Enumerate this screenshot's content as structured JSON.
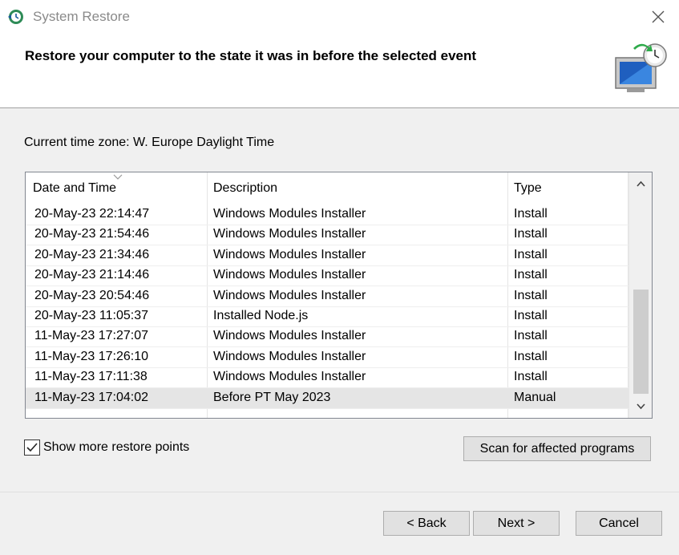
{
  "window": {
    "title": "System Restore",
    "close_label": "×"
  },
  "header": {
    "text": "Restore your computer to the state it was in before the selected event"
  },
  "timezone": {
    "label": "Current time zone: W. Europe Daylight Time"
  },
  "list": {
    "columns": [
      "Date and Time",
      "Description",
      "Type"
    ],
    "rows": [
      {
        "date": "20-May-23 22:14:47",
        "description": "Windows Modules Installer",
        "type": "Install"
      },
      {
        "date": "20-May-23 21:54:46",
        "description": "Windows Modules Installer",
        "type": "Install"
      },
      {
        "date": "20-May-23 21:34:46",
        "description": "Windows Modules Installer",
        "type": "Install"
      },
      {
        "date": "20-May-23 21:14:46",
        "description": "Windows Modules Installer",
        "type": "Install"
      },
      {
        "date": "20-May-23 20:54:46",
        "description": "Windows Modules Installer",
        "type": "Install"
      },
      {
        "date": "20-May-23 11:05:37",
        "description": "Installed Node.js",
        "type": "Install"
      },
      {
        "date": "11-May-23 17:27:07",
        "description": "Windows Modules Installer",
        "type": "Install"
      },
      {
        "date": "11-May-23 17:26:10",
        "description": "Windows Modules Installer",
        "type": "Install"
      },
      {
        "date": "11-May-23 17:11:38",
        "description": "Windows Modules Installer",
        "type": "Install"
      },
      {
        "date": "11-May-23 17:04:02",
        "description": "Before PT May 2023",
        "type": "Manual"
      }
    ],
    "selected_index": 9
  },
  "options": {
    "show_more_label": "Show more restore points",
    "show_more_checked": true
  },
  "buttons": {
    "scan": "Scan for affected programs",
    "back": "< Back",
    "next": "Next >",
    "cancel": "Cancel"
  },
  "colors": {
    "window_bg": "#f0f0f0",
    "selected_row": "#e5e5e5",
    "header_bg": "#ffffff"
  }
}
